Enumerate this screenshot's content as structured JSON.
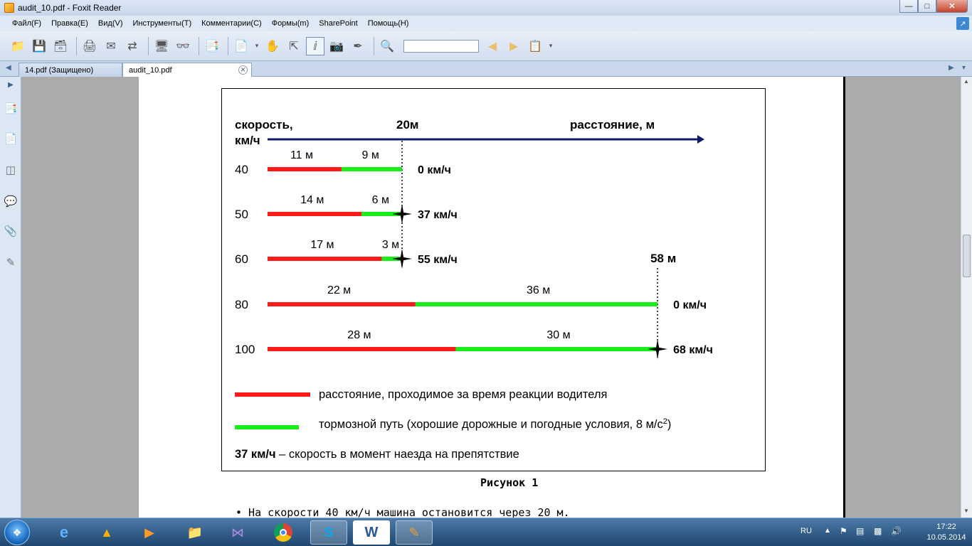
{
  "window": {
    "title": "audit_10.pdf - Foxit Reader"
  },
  "menu": [
    "Файл(F)",
    "Правка(E)",
    "Вид(V)",
    "Инструменты(T)",
    "Комментарии(C)",
    "Формы(m)",
    "SharePoint",
    "Помощь(H)"
  ],
  "tabs": [
    {
      "label": "14.pdf (Защищено)"
    },
    {
      "label": "audit_10.pdf"
    }
  ],
  "figure": {
    "caption": "Рисунок 1",
    "y_axis_label_line1": "скорость,",
    "y_axis_label_line2": "км/ч",
    "axis_marker": "20м",
    "x_axis_label": "расстояние, м",
    "marker_58": "58 м",
    "rows": [
      {
        "speed": "40",
        "reaction": 11,
        "braking": 9,
        "reaction_label": "11 м",
        "braking_label": "9 м",
        "impact": "0 км/ч",
        "crash": false
      },
      {
        "speed": "50",
        "reaction": 14,
        "braking": 6,
        "reaction_label": "14 м",
        "braking_label": "6 м",
        "impact": "37 км/ч",
        "crash": true
      },
      {
        "speed": "60",
        "reaction": 17,
        "braking": 3,
        "reaction_label": "17 м",
        "braking_label": "3 м",
        "impact": "55 км/ч",
        "crash": true
      },
      {
        "speed": "80",
        "reaction": 22,
        "braking": 36,
        "reaction_label": "22 м",
        "braking_label": "36 м",
        "impact": "0 км/ч",
        "crash": false
      },
      {
        "speed": "100",
        "reaction": 28,
        "braking": 30,
        "reaction_label": "28 м",
        "braking_label": "30 м",
        "impact": "68 км/ч",
        "crash": true
      }
    ],
    "legend": {
      "reaction": "расстояние, проходимое за время реакции водителя",
      "braking": "тормозной путь (хорошие дорожные и погодные условия, 8 м/с",
      "braking_sup": "2",
      "braking_end": ")",
      "impact_bold": "37 км/ч",
      "impact_text": " – скорость в момент наезда на препятствие"
    },
    "colors": {
      "reaction": "#ff1a1a",
      "braking": "#1aee1a",
      "axis": "#0d1a66"
    }
  },
  "body_text": "•  На скорости 40 км/ч машина остановится через 20 м.",
  "taskbar": {
    "language": "RU",
    "time": "17:22",
    "date": "10.05.2014"
  }
}
